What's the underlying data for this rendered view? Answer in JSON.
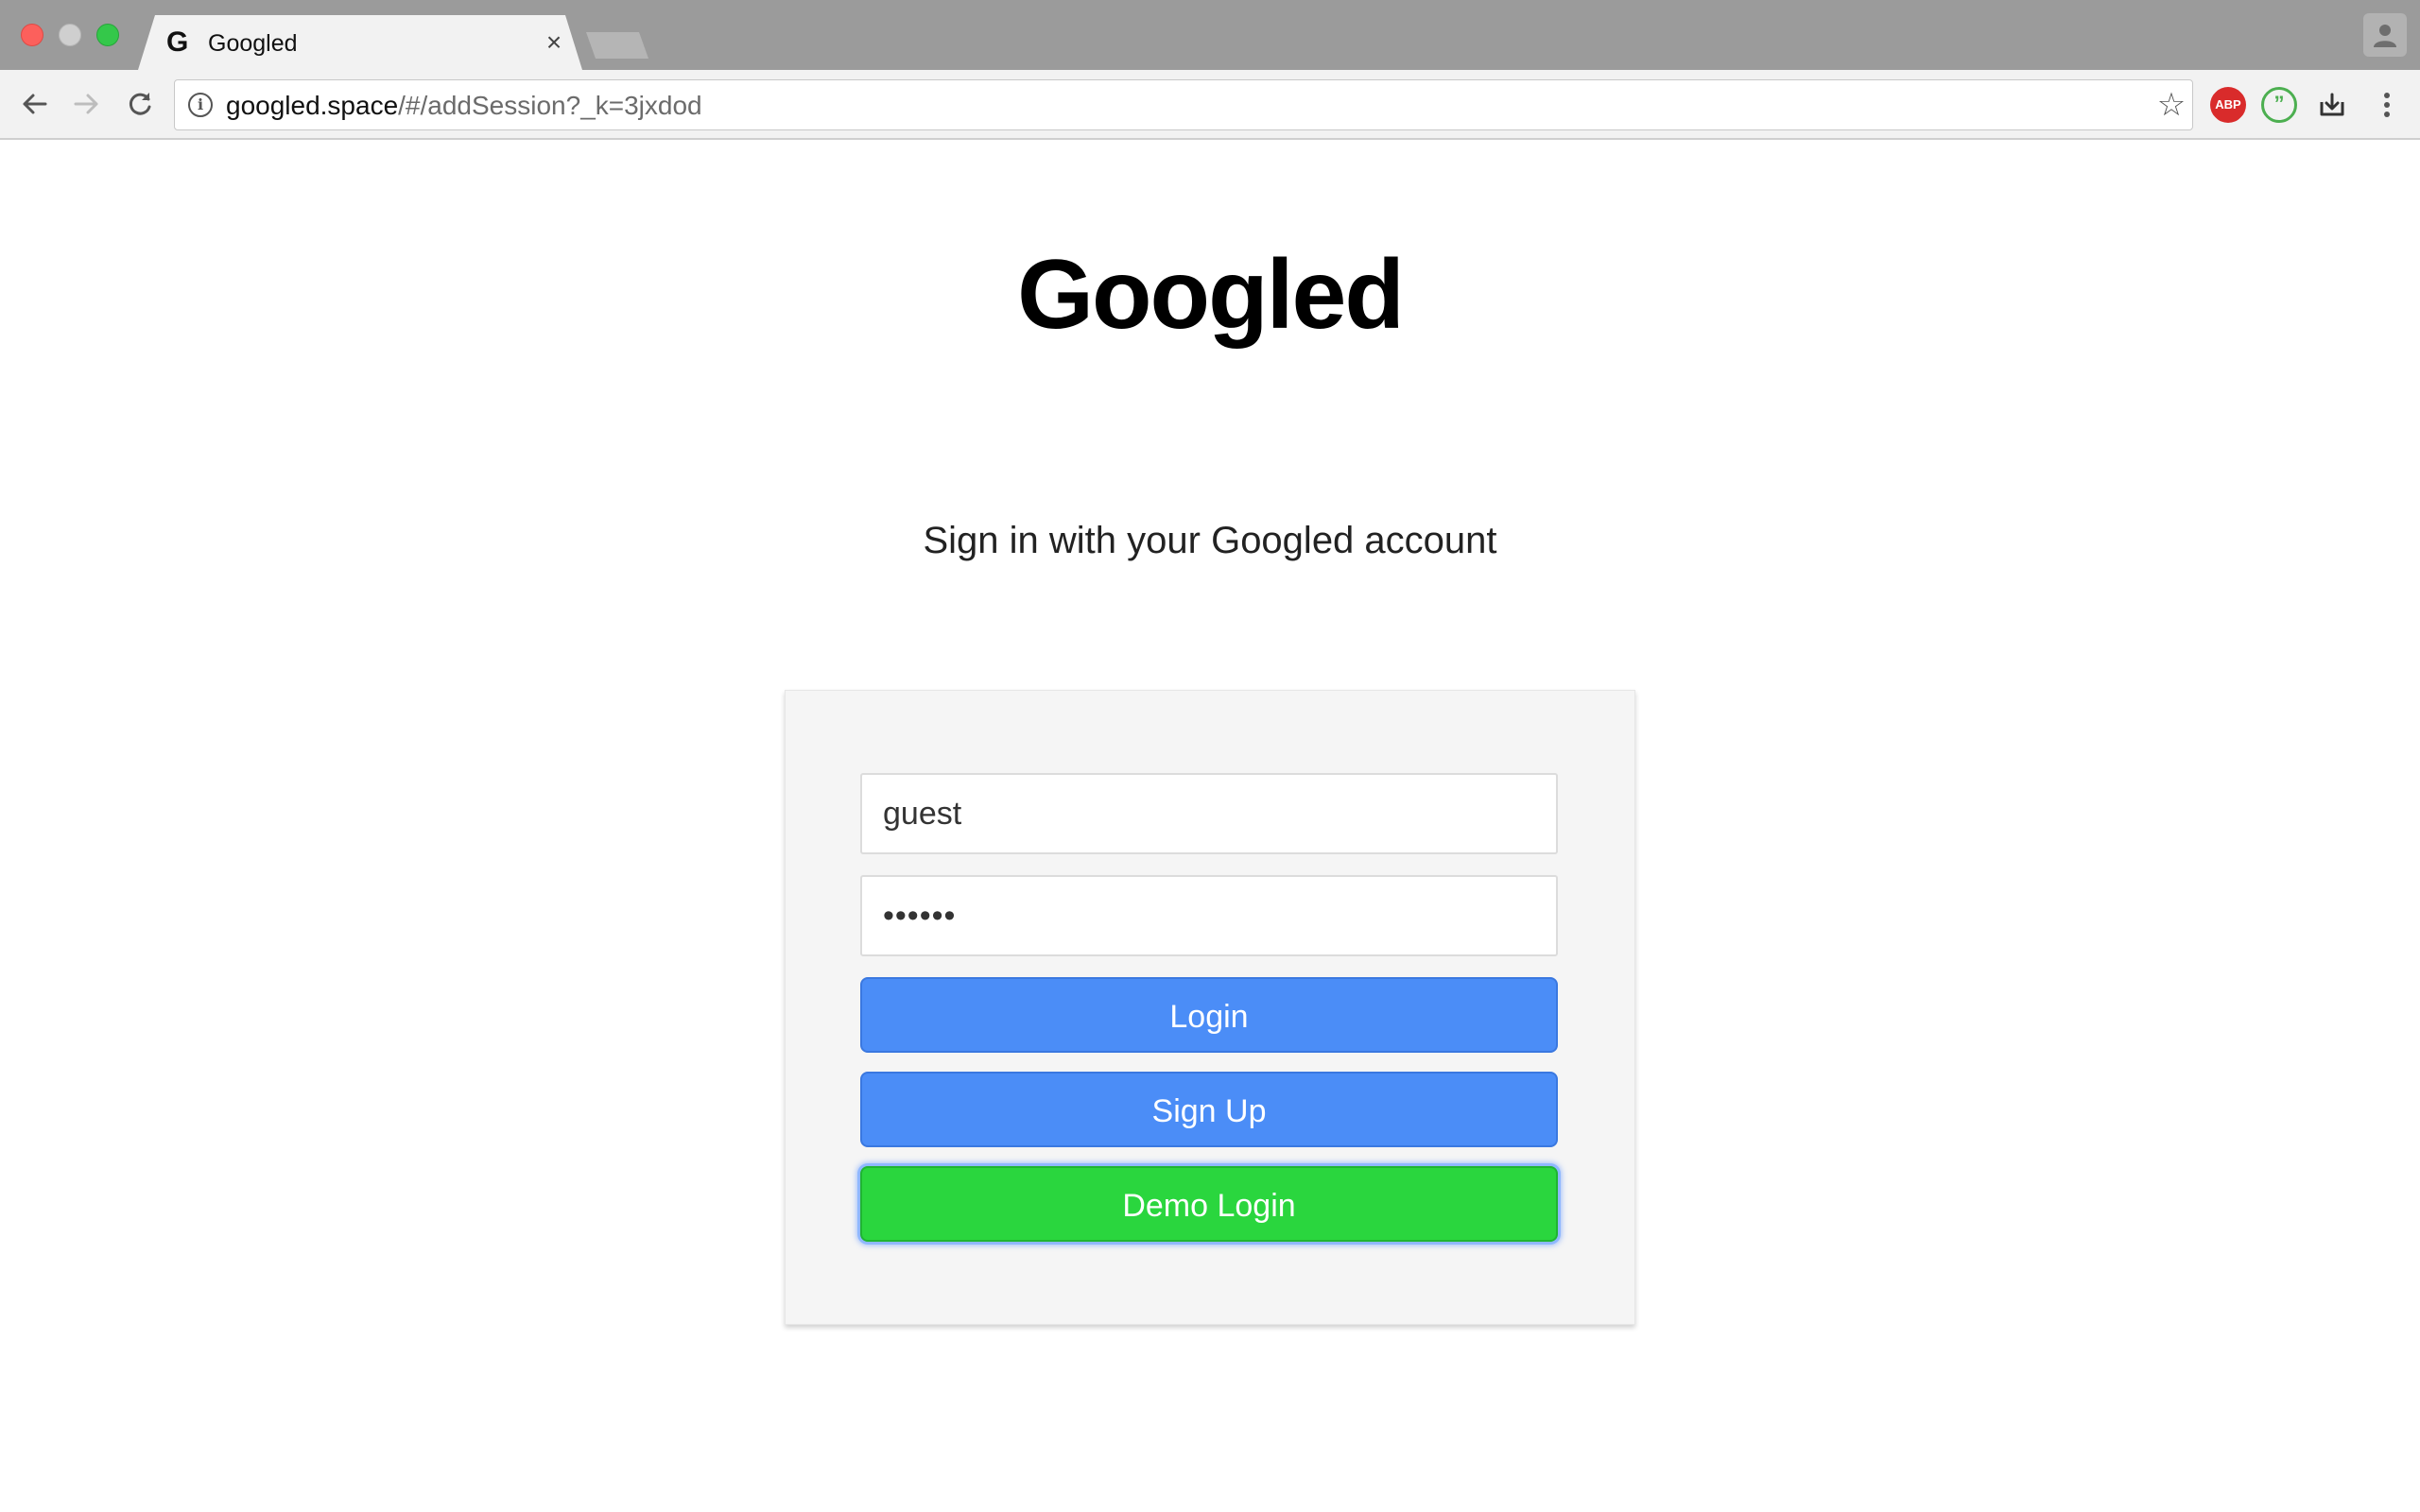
{
  "browser": {
    "tab": {
      "favicon": "G",
      "title": "Googled",
      "close": "×"
    },
    "address": {
      "host": "googled.space",
      "path": "/#/addSession?_k=3jxdod"
    },
    "extensions": {
      "adblock_label": "ABP",
      "hangouts_label": "”"
    },
    "icons": [
      "back-arrow-icon",
      "forward-arrow-icon",
      "reload-icon",
      "info-icon",
      "star-icon",
      "adblock-icon",
      "hangouts-icon",
      "save-icon",
      "more-menu-icon",
      "profile-icon"
    ]
  },
  "page": {
    "logo": "Googled",
    "subtitle": "Sign in with your Googled account",
    "form": {
      "username_value": "guest",
      "password_value": "••••••",
      "login_label": "Login",
      "signup_label": "Sign Up",
      "demo_label": "Demo Login"
    },
    "colors": {
      "primary_button": "#4b8df7",
      "demo_button": "#2ad63e",
      "focus_ring": "#8fb8ff"
    }
  }
}
